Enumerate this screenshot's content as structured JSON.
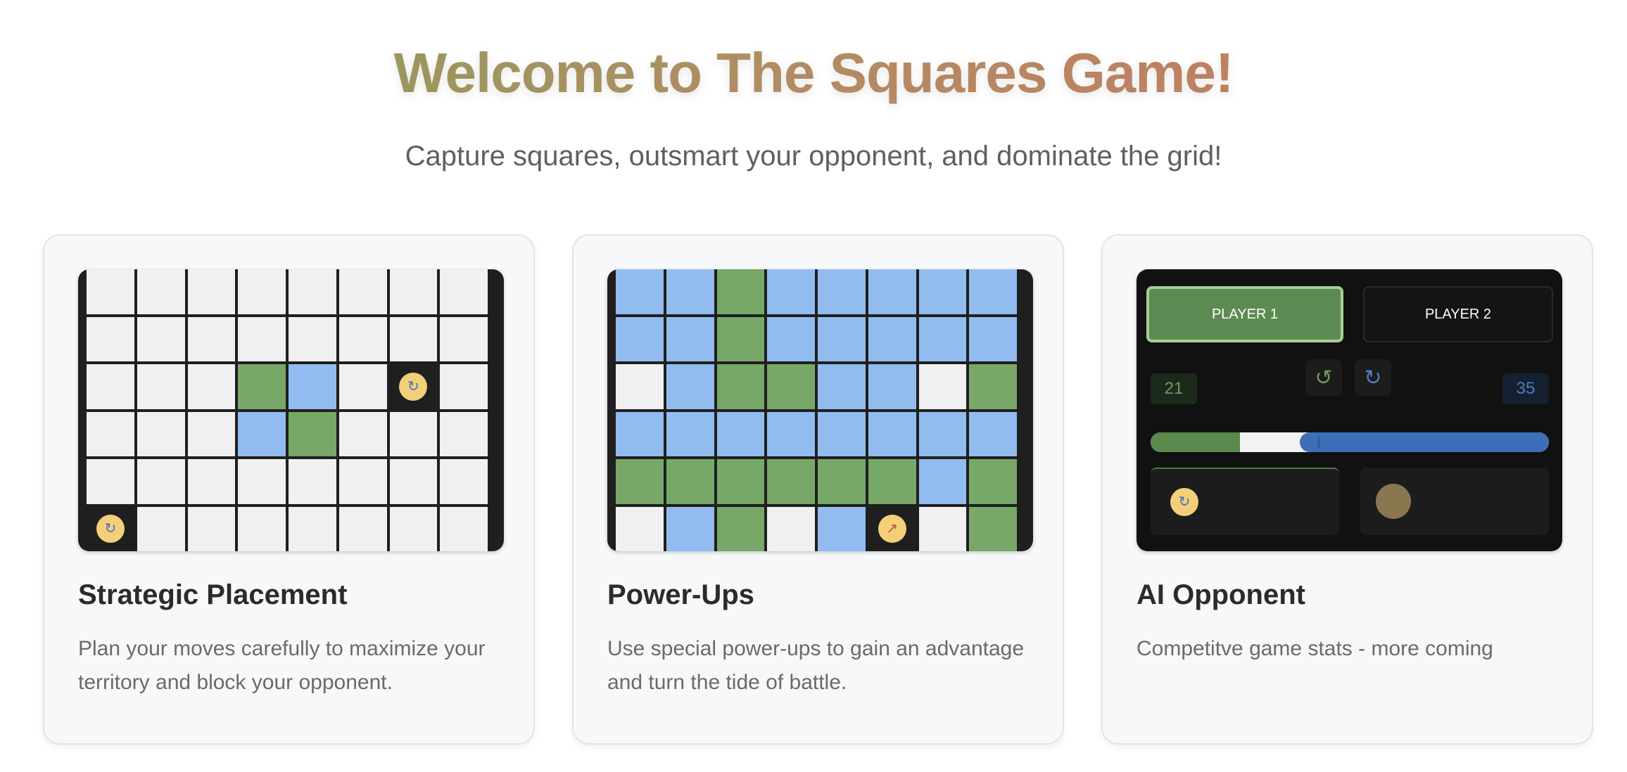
{
  "hero": {
    "title": "Welcome to The Squares Game!",
    "subtitle": "Capture squares, outsmart your opponent, and dominate the grid!"
  },
  "colors": {
    "player1": "#78a868",
    "player2": "#92bcf0",
    "empty": "#f0f0f0",
    "board": "#1f1f1f",
    "powerup": "#f3cf7a"
  },
  "features": [
    {
      "title": "Strategic Placement",
      "description": "Plan your moves carefully to maximize your territory and block your opponent.",
      "grid": [
        "eeeeeeee",
        "eeeeeeee",
        "eeegbePe",
        "eeebgeee",
        "eeeeeeee",
        "Peeeeeee"
      ],
      "powerup_icon": "swap-icon"
    },
    {
      "title": "Power-Ups",
      "description": "Use special power-ups to gain an advantage and turn the tide of battle.",
      "grid": [
        "bbgbbbbb",
        "bbgbbbbb",
        "ebggbbeg",
        "bbbbbbbb",
        "ggggggbg",
        "ebgebReg"
      ],
      "powerup_icon": "rocket-icon"
    },
    {
      "title": "AI Opponent",
      "description": "Competitve game stats - more coming"
    }
  ],
  "dashboard": {
    "player1_label": "PLAYER 1",
    "player2_label": "PLAYER 2",
    "player1_score": "21",
    "player2_score": "35",
    "undo_icon": "undo-icon",
    "redo_icon": "redo-icon",
    "player1_share": 0.375,
    "player2_share": 0.625,
    "inventory_p1_icon": "swap-icon"
  }
}
